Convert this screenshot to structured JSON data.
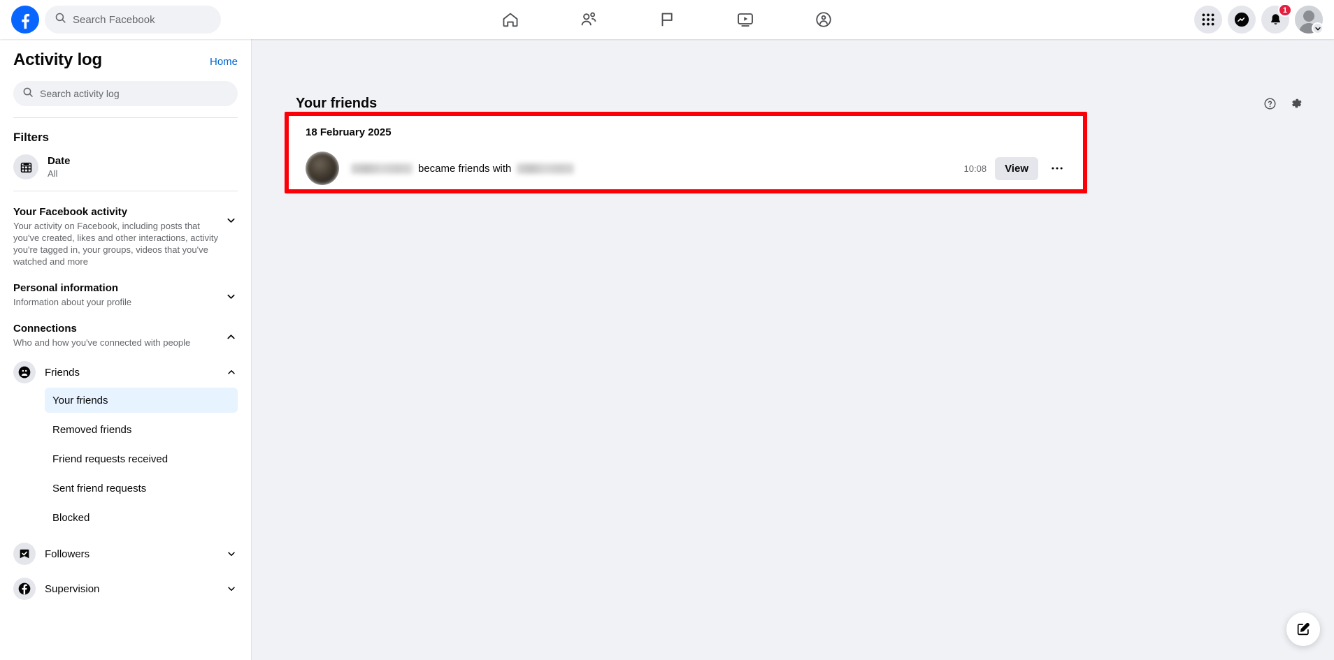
{
  "topnav": {
    "logo_icon": "facebook-logo-icon",
    "search": {
      "placeholder": "Search Facebook",
      "value": "",
      "icon": "search-icon"
    },
    "tabs": [
      {
        "name": "home",
        "icon": "home-icon"
      },
      {
        "name": "friends",
        "icon": "friends-icon"
      },
      {
        "name": "pages",
        "icon": "flag-icon"
      },
      {
        "name": "video",
        "icon": "video-icon"
      },
      {
        "name": "groups",
        "icon": "groups-icon"
      }
    ],
    "right": {
      "menu_icon": "grid-menu-icon",
      "messenger_icon": "messenger-icon",
      "notifications_icon": "bell-icon",
      "notifications_badge": "1",
      "avatar_icon": "avatar-icon",
      "avatar_caret_icon": "chevron-down-icon"
    }
  },
  "sidebar": {
    "title": "Activity log",
    "home_link": "Home",
    "search": {
      "placeholder": "Search activity log",
      "value": "",
      "icon": "search-icon"
    },
    "filters_heading": "Filters",
    "filters": [
      {
        "name": "Date",
        "value": "All",
        "icon": "calendar-icon"
      }
    ],
    "sections": [
      {
        "title": "Your Facebook activity",
        "desc": "Your activity on Facebook, including posts that you've created, likes and other interactions, activity you're tagged in, your groups, videos that you've watched and more",
        "expanded": false,
        "chevron": "chevron-down-icon"
      },
      {
        "title": "Personal information",
        "desc": "Information about your profile",
        "expanded": false,
        "chevron": "chevron-down-icon"
      },
      {
        "title": "Connections",
        "desc": "Who and how you've connected with people",
        "expanded": true,
        "chevron": "chevron-up-icon"
      }
    ],
    "groups": [
      {
        "label": "Friends",
        "icon": "friends-circle-icon",
        "expanded": true,
        "chevron": "chevron-up-icon",
        "items": [
          {
            "label": "Your friends",
            "active": true
          },
          {
            "label": "Removed friends",
            "active": false
          },
          {
            "label": "Friend requests received",
            "active": false
          },
          {
            "label": "Sent friend requests",
            "active": false
          },
          {
            "label": "Blocked",
            "active": false
          }
        ]
      },
      {
        "label": "Followers",
        "icon": "followers-check-icon",
        "expanded": false,
        "chevron": "chevron-down-icon",
        "items": []
      },
      {
        "label": "Supervision",
        "icon": "facebook-circle-icon",
        "expanded": false,
        "chevron": "chevron-down-icon",
        "items": []
      }
    ]
  },
  "main": {
    "title": "Your friends",
    "help_icon": "help-circle-icon",
    "settings_icon": "gear-icon",
    "highlight_color": "#fb0007",
    "card": {
      "date": "18 February 2025",
      "avatar_icon": "user-avatar-icon",
      "actor_name": "",
      "action_text": "became friends with",
      "target_name": "",
      "time": "10:08",
      "view_label": "View",
      "more_icon": "ellipsis-icon"
    }
  },
  "fab": {
    "icon": "compose-pencil-icon"
  }
}
